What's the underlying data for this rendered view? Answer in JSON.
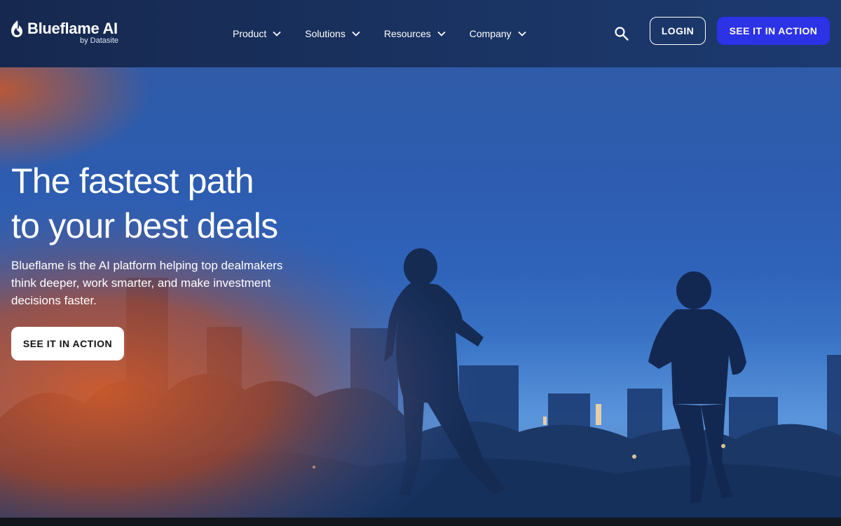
{
  "brand": {
    "name": "Blueflame AI",
    "sub": "by Datasite"
  },
  "nav": {
    "items": [
      {
        "label": "Product"
      },
      {
        "label": "Solutions"
      },
      {
        "label": "Resources"
      },
      {
        "label": "Company"
      }
    ]
  },
  "header": {
    "login_label": "LOGIN",
    "cta_label": "SEE IT IN ACTION"
  },
  "hero": {
    "title_line1": "The fastest path",
    "title_line2": "to your best deals",
    "subtitle": "Blueflame is the AI platform helping top dealmakers think deeper, work smarter, and make investment decisions faster.",
    "cta_label": "SEE IT IN ACTION"
  },
  "colors": {
    "header_bg": "#1a3362",
    "cta_blue": "#2c32e6",
    "sky": "#2f63ba",
    "flare": "#c2532a"
  },
  "icons": [
    "flame-logo-icon",
    "chevron-down-icon",
    "search-icon"
  ]
}
